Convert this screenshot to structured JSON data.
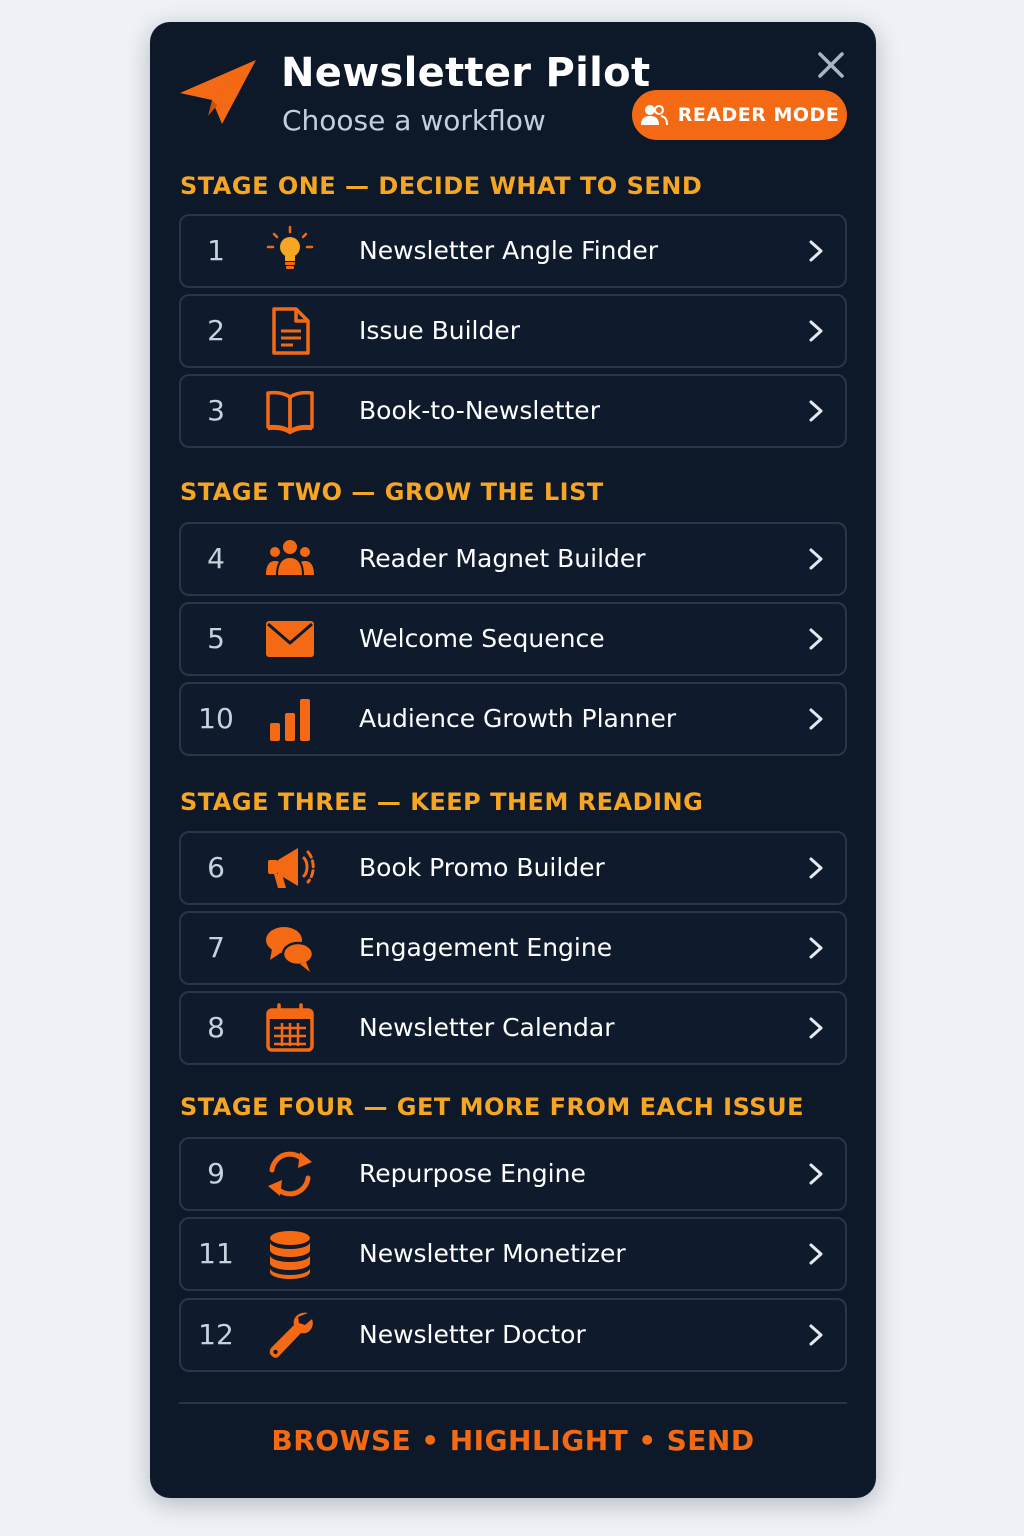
{
  "header": {
    "title": "Newsletter Pilot",
    "subtitle": "Choose a workflow",
    "mode_button": "READER MODE",
    "logo_icon": "paper-plane-icon",
    "close_icon": "close-icon"
  },
  "colors": {
    "accent": "#f46a14",
    "stage_heading": "#f6a623",
    "panel_bg": "#0d1828",
    "row_border": "#2a3647",
    "page_bg": "#eef1f5"
  },
  "stages": [
    {
      "title": "STAGE ONE — DECIDE WHAT TO SEND",
      "items": [
        {
          "number": "1",
          "label": "Newsletter Angle Finder",
          "icon": "lightbulb-icon"
        },
        {
          "number": "2",
          "label": "Issue Builder",
          "icon": "document-icon"
        },
        {
          "number": "3",
          "label": "Book-to-Newsletter",
          "icon": "open-book-icon"
        }
      ]
    },
    {
      "title": "STAGE TWO — GROW THE LIST",
      "items": [
        {
          "number": "4",
          "label": "Reader Magnet Builder",
          "icon": "group-icon"
        },
        {
          "number": "5",
          "label": "Welcome Sequence",
          "icon": "envelope-icon"
        },
        {
          "number": "10",
          "label": "Audience Growth Planner",
          "icon": "bar-chart-icon"
        }
      ]
    },
    {
      "title": "STAGE THREE — KEEP THEM READING",
      "items": [
        {
          "number": "6",
          "label": "Book Promo Builder",
          "icon": "megaphone-icon"
        },
        {
          "number": "7",
          "label": "Engagement Engine",
          "icon": "chat-bubbles-icon"
        },
        {
          "number": "8",
          "label": "Newsletter Calendar",
          "icon": "calendar-icon"
        }
      ]
    },
    {
      "title": "STAGE FOUR — GET MORE FROM EACH ISSUE",
      "items": [
        {
          "number": "9",
          "label": "Repurpose Engine",
          "icon": "refresh-icon"
        },
        {
          "number": "11",
          "label": "Newsletter Monetizer",
          "icon": "database-icon"
        },
        {
          "number": "12",
          "label": "Newsletter Doctor",
          "icon": "wrench-icon"
        }
      ]
    }
  ],
  "footer": {
    "items": [
      "BROWSE",
      "HIGHLIGHT",
      "SEND"
    ],
    "separator": "•"
  }
}
